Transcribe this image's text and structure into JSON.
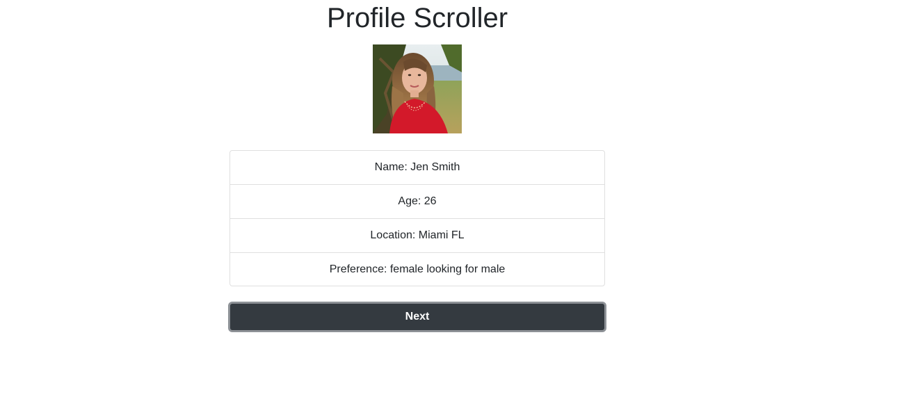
{
  "header": {
    "title": "Profile Scroller"
  },
  "profile": {
    "photo_icon": "profile-photo",
    "fields": [
      {
        "text": "Name: Jen Smith"
      },
      {
        "text": "Age: 26"
      },
      {
        "text": "Location: Miami FL"
      },
      {
        "text": "Preference: female looking for male"
      }
    ]
  },
  "actions": {
    "next_label": "Next"
  },
  "colors": {
    "button_bg": "#343a40",
    "button_border": "#8e9297",
    "list_border": "#dfdfdf",
    "text": "#212529"
  }
}
